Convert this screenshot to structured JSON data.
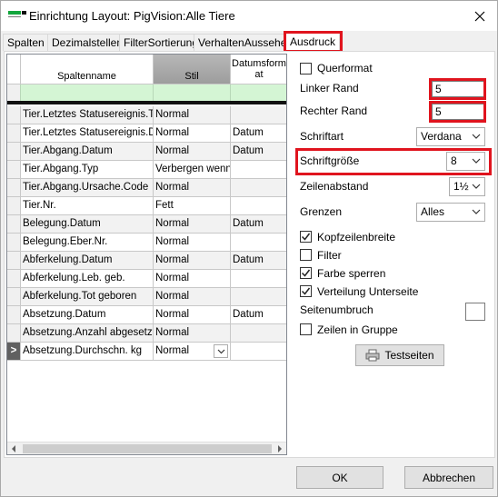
{
  "window": {
    "title": "Einrichtung Layout: PigVision:Alle Tiere"
  },
  "tabs": [
    {
      "label": "Spalten"
    },
    {
      "label": "Dezimalstellen"
    },
    {
      "label": "FilterSortierung"
    },
    {
      "label": "VerhaltenAussehen"
    },
    {
      "label": "Ausdruck",
      "active": true
    }
  ],
  "grid": {
    "columns": [
      "Spaltenname",
      "Stil",
      "Datumsform at"
    ],
    "rows": [
      {
        "name": "Tier.Letztes Statusereignis.T",
        "style": "Normal",
        "date": ""
      },
      {
        "name": "Tier.Letztes Statusereignis.D",
        "style": "Normal",
        "date": "Datum"
      },
      {
        "name": "Tier.Abgang.Datum",
        "style": "Normal",
        "date": "Datum"
      },
      {
        "name": "Tier.Abgang.Typ",
        "style": "Verbergen wenn",
        "date": ""
      },
      {
        "name": "Tier.Abgang.Ursache.Code",
        "style": "Normal",
        "date": ""
      },
      {
        "name": "Tier.Nr.",
        "style": "Fett",
        "date": ""
      },
      {
        "name": "Belegung.Datum",
        "style": "Normal",
        "date": "Datum"
      },
      {
        "name": "Belegung.Eber.Nr.",
        "style": "Normal",
        "date": ""
      },
      {
        "name": "Abferkelung.Datum",
        "style": "Normal",
        "date": "Datum"
      },
      {
        "name": "Abferkelung.Leb. geb.",
        "style": "Normal",
        "date": ""
      },
      {
        "name": "Abferkelung.Tot geboren",
        "style": "Normal",
        "date": ""
      },
      {
        "name": "Absetzung.Datum",
        "style": "Normal",
        "date": "Datum"
      },
      {
        "name": "Absetzung.Anzahl abgesetzt",
        "style": "Normal",
        "date": ""
      },
      {
        "name": "Absetzung.Durchschn. kg",
        "style": "Normal",
        "date": "",
        "current": true
      }
    ],
    "current_row_marker": ">"
  },
  "settings": {
    "querformat": {
      "label": "Querformat",
      "checked": false
    },
    "linker_rand": {
      "label": "Linker Rand",
      "value": "5"
    },
    "rechter_rand": {
      "label": "Rechter Rand",
      "value": "5"
    },
    "schriftart": {
      "label": "Schriftart",
      "value": "Verdana"
    },
    "schriftgroesse": {
      "label": "Schriftgröße",
      "value": "8"
    },
    "zeilenabstand": {
      "label": "Zeilenabstand",
      "value": "1½"
    },
    "grenzen": {
      "label": "Grenzen",
      "value": "Alles"
    },
    "kopfzeilenbreite": {
      "label": "Kopfzeilenbreite",
      "checked": true
    },
    "filter": {
      "label": "Filter",
      "checked": false
    },
    "farbe_sperren": {
      "label": "Farbe sperren",
      "checked": true
    },
    "verteilung_unterseite": {
      "label": "Verteilung Unterseite",
      "checked": true
    },
    "seitenumbruch": {
      "label": "Seitenumbruch"
    },
    "zeilen_in_gruppe": {
      "label": "Zeilen in Gruppe",
      "checked": false
    },
    "testseiten": {
      "label": "Testseiten"
    }
  },
  "footer": {
    "ok": "OK",
    "cancel": "Abbrechen"
  },
  "colors": {
    "highlight": "#e0141e",
    "filter_row": "#d4f5d4",
    "app_green": "#12a63c"
  }
}
